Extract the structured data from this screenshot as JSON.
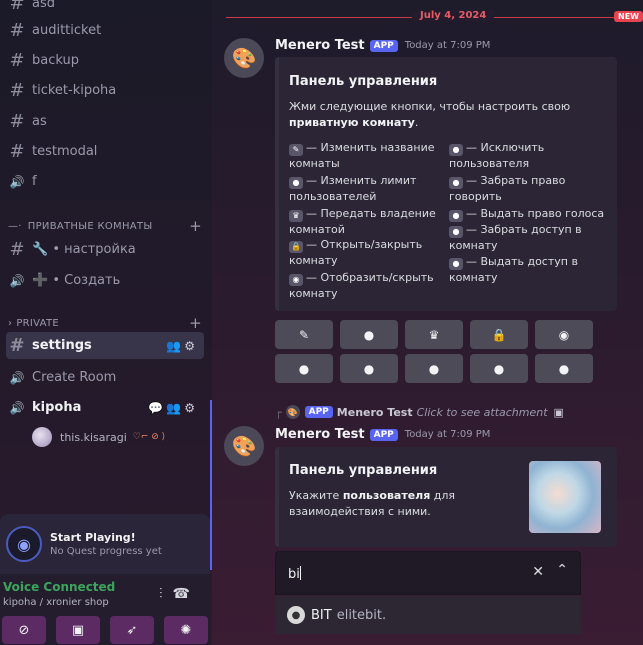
{
  "sidebar": {
    "channels_top": [
      {
        "icon": "#",
        "label": "asd"
      },
      {
        "icon": "#",
        "label": "auditticket"
      },
      {
        "icon": "#",
        "label": "backup"
      },
      {
        "icon": "#",
        "label": "ticket-kipoha"
      },
      {
        "icon": "#",
        "label": "as"
      },
      {
        "icon": "#",
        "label": "testmodal"
      },
      {
        "icon": "🔊",
        "label": "f"
      }
    ],
    "category_private_rooms": "ПРИВАТНЫЕ КОМНАТЫ",
    "private_rooms": [
      {
        "icon": "#",
        "label": "🔧 • настройка"
      },
      {
        "icon": "🔊",
        "label": "➕ • Создать"
      }
    ],
    "category_private": "PRIVATE",
    "private_channels": [
      {
        "icon": "#",
        "label": "settings"
      },
      {
        "icon": "🔊",
        "label": "Create Room"
      },
      {
        "icon": "🔊",
        "label": "kipoha"
      }
    ],
    "voice_user": "this.kisaragi",
    "quest": {
      "title": "Start Playing!",
      "subtitle": "No Quest progress yet"
    },
    "voice": {
      "status": "Voice Connected",
      "location": "kipoha / xronier shop"
    }
  },
  "main": {
    "date_divider": "July 4, 2024",
    "new_badge": "NEW",
    "message1": {
      "author": "Menero Test",
      "tag": "APP",
      "timestamp": "Today at 7:09 PM",
      "embed_title": "Панель управления",
      "embed_desc_1": "Жми следующие кнопки, чтобы настроить свою",
      "embed_desc_2": "приватную комнату",
      "fields_left": [
        "— Изменить название комнаты",
        "— Изменить лимит пользователей",
        "— Передать владение комнатой",
        "— Открыть/закрыть комнату",
        "— Отобразить/скрыть комнату"
      ],
      "fields_right": [
        "— Исключить пользователя",
        "— Забрать право говорить",
        "— Выдать право голоса",
        "— Забрать доступ в комнату",
        "— Выдать доступ в комнату"
      ]
    },
    "reply": {
      "tag": "APP",
      "author": "Menero Test",
      "text": "Click to see attachment"
    },
    "message2": {
      "author": "Menero Test",
      "tag": "APP",
      "timestamp": "Today at 7:09 PM",
      "embed_title": "Панель управления",
      "embed_desc_1": "Укажите",
      "embed_desc_bold": "пользователя",
      "embed_desc_2": "для взаимодействия с ними."
    },
    "select": {
      "value": "bi"
    },
    "option": {
      "name": "BIT",
      "sub": "elitebit."
    }
  }
}
